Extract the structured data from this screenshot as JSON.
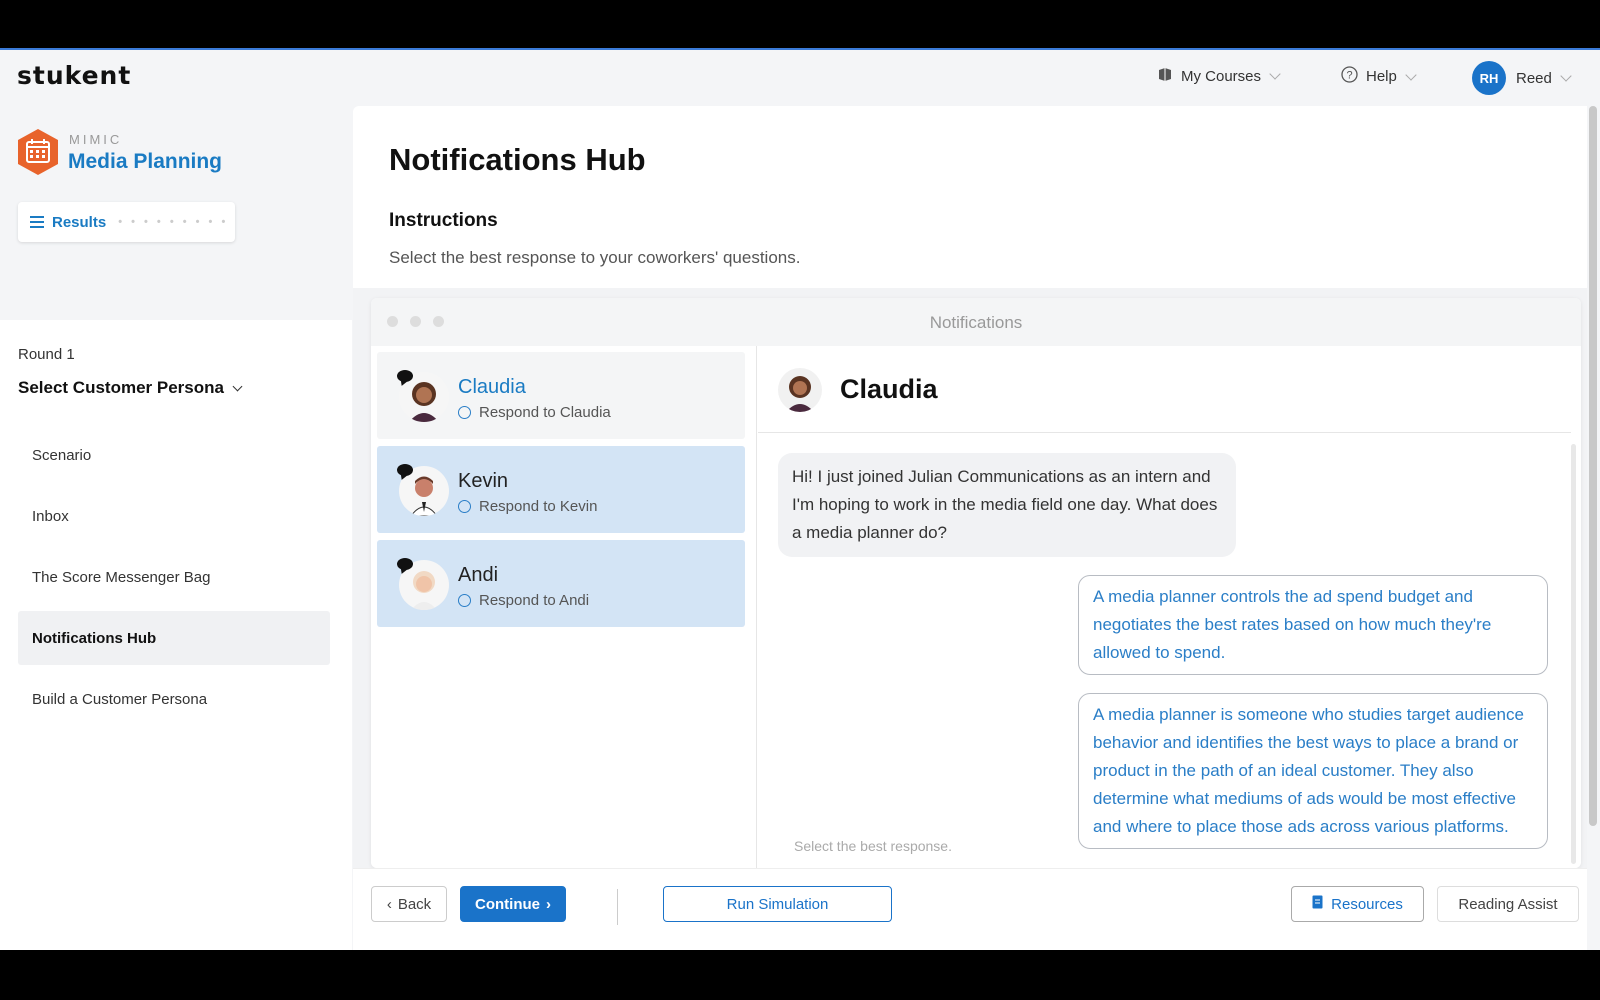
{
  "header": {
    "logo": "stukent",
    "my_courses": "My Courses",
    "help": "Help",
    "user_initials": "RH",
    "user_name": "Reed"
  },
  "sidebar": {
    "brand_sub": "MIMIC",
    "brand_title": "Media Planning",
    "results_label": "Results",
    "results_dots": "• • • • • • • • •",
    "round_label": "Round 1",
    "persona_label": "Select Customer Persona",
    "items": [
      {
        "label": "Scenario",
        "active": false
      },
      {
        "label": "Inbox",
        "active": false
      },
      {
        "label": "The Score Messenger Bag",
        "active": false
      },
      {
        "label": "Notifications Hub",
        "active": true
      },
      {
        "label": "Build a Customer Persona",
        "active": false
      }
    ]
  },
  "main": {
    "title": "Notifications Hub",
    "instructions_title": "Instructions",
    "instructions_text": "Select the best response to your coworkers' questions.",
    "window_title": "Notifications",
    "contacts": [
      {
        "name": "Claudia",
        "respond": "Respond to Claudia"
      },
      {
        "name": "Kevin",
        "respond": "Respond to Kevin"
      },
      {
        "name": "Andi",
        "respond": "Respond to Andi"
      }
    ],
    "chat": {
      "name": "Claudia",
      "incoming": "Hi! I just joined Julian Communications as an intern and I'm hoping to work in the media field one day. What does a media planner do?",
      "options": [
        "A media planner controls the ad spend budget and negotiates the best rates based on how much they're allowed to spend.",
        "A media planner is someone who studies target audience behavior and identifies the best ways to place a brand or product in the path of an ideal customer. They also determine what mediums of ads would be most effective and where to place those ads across various platforms."
      ],
      "hint": "Select the best response."
    }
  },
  "footer": {
    "back": "Back",
    "continue": "Continue",
    "run_simulation": "Run Simulation",
    "resources": "Resources",
    "reading_assist": "Reading Assist"
  },
  "colors": {
    "accent": "#1a73c9",
    "link": "#1a7bc3",
    "brand_orange": "#e8632b",
    "unselected_contact": "#d3e4f5"
  }
}
